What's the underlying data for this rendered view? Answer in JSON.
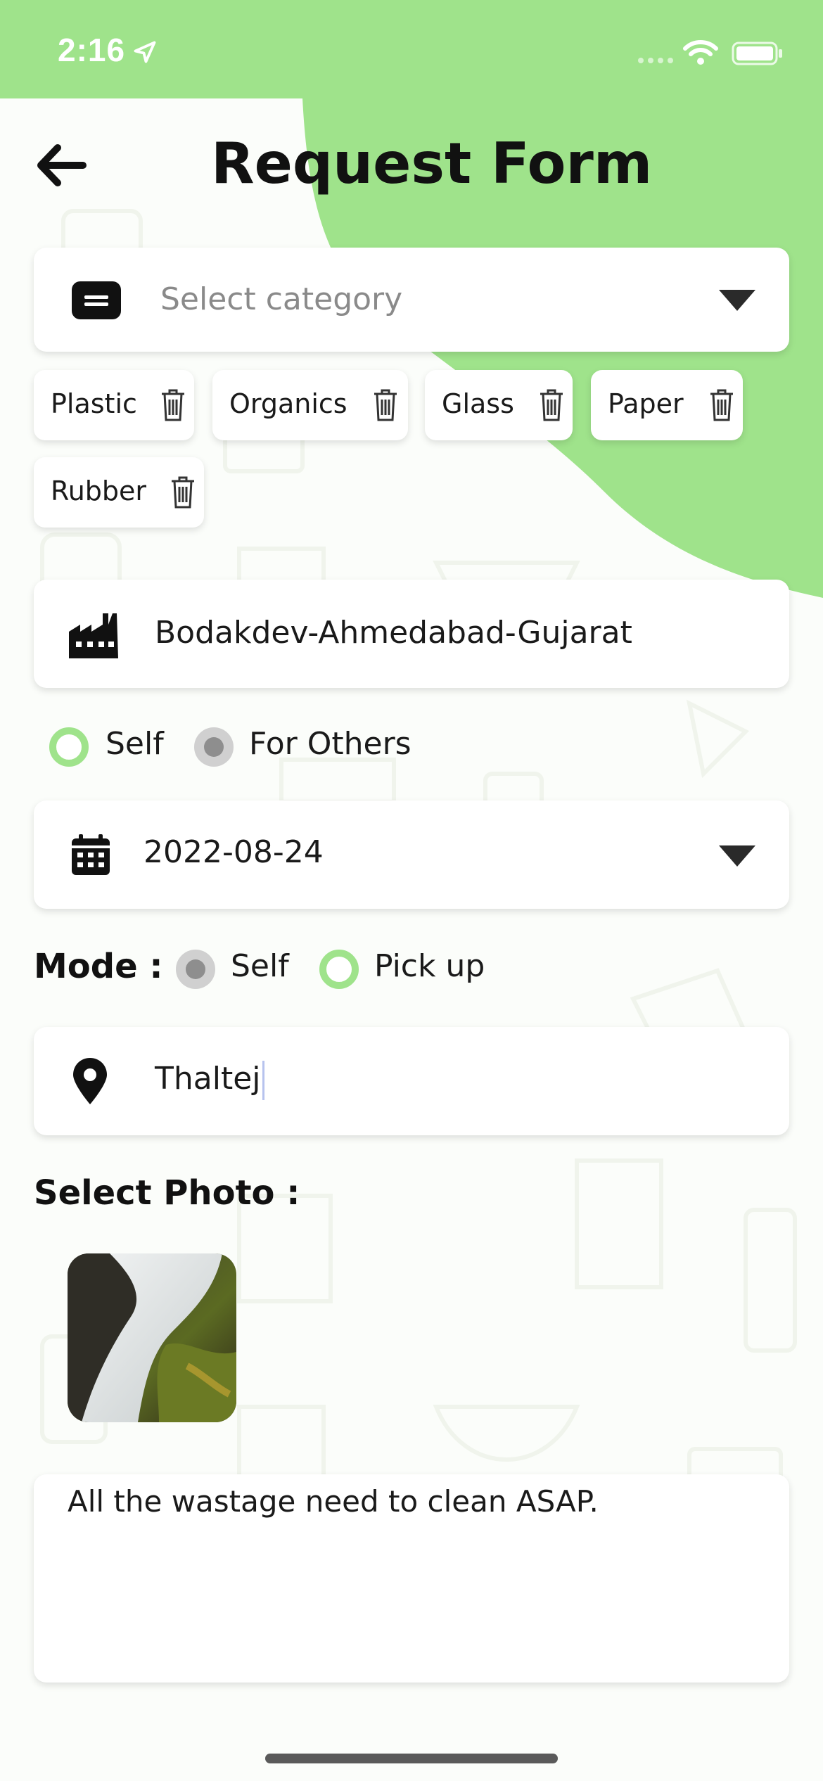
{
  "status_bar": {
    "time": "2:16",
    "icons": [
      "location-arrow-icon",
      "signal-dots-icon",
      "wifi-icon",
      "battery-icon"
    ]
  },
  "header": {
    "title": "Request Form",
    "back_icon": "arrow-left-icon"
  },
  "category": {
    "icon": "category-card-icon",
    "placeholder": "Select category",
    "dropdown_icon": "caret-down-icon"
  },
  "selected_categories": [
    {
      "label": "Plastic"
    },
    {
      "label": "Organics"
    },
    {
      "label": "Glass"
    },
    {
      "label": "Paper"
    },
    {
      "label": "Rubber"
    }
  ],
  "address": {
    "icon": "factory-icon",
    "value": "Bodakdev-Ahmedabad-Gujarat"
  },
  "request_for": {
    "options": [
      {
        "label": "Self",
        "selected": true
      },
      {
        "label": "For Others",
        "selected": false
      }
    ]
  },
  "date": {
    "icon": "calendar-icon",
    "value": "2022-08-24",
    "dropdown_icon": "caret-down-icon"
  },
  "mode": {
    "label": "Mode :",
    "options": [
      {
        "label": "Self",
        "selected": false
      },
      {
        "label": "Pick up",
        "selected": true
      }
    ]
  },
  "location": {
    "icon": "map-pin-icon",
    "value": "Thaltej"
  },
  "photo": {
    "label": "Select Photo :",
    "thumbnail": "waterfall-photo"
  },
  "description": {
    "value": "All the wastage need to clean ASAP."
  },
  "colors": {
    "accent_green": "#9fe38b",
    "background": "#fbfdfa",
    "text": "#111111",
    "placeholder": "#8a8a8a"
  }
}
